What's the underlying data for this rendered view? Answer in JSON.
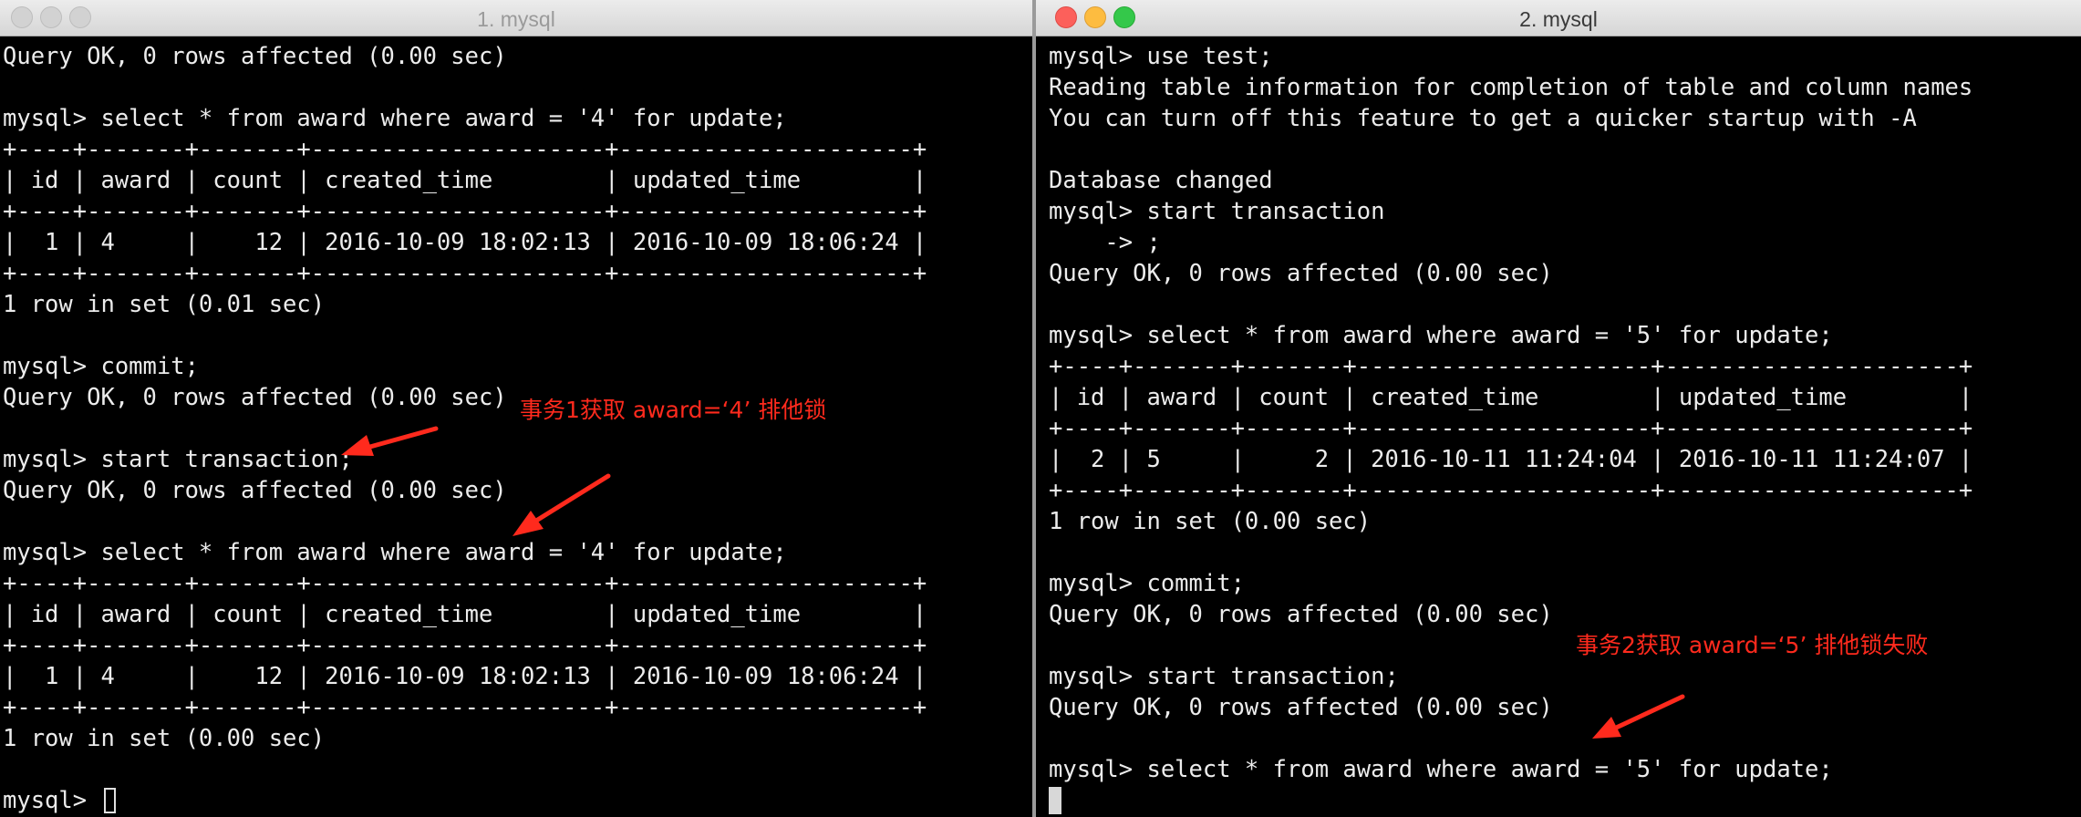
{
  "window1": {
    "title": "1. mysql",
    "lines": [
      "Query OK, 0 rows affected (0.00 sec)",
      "",
      "mysql> select * from award where award = '4' for update;",
      "+----+-------+-------+---------------------+---------------------+",
      "| id | award | count | created_time        | updated_time        |",
      "+----+-------+-------+---------------------+---------------------+",
      "|  1 | 4     |    12 | 2016-10-09 18:02:13 | 2016-10-09 18:06:24 |",
      "+----+-------+-------+---------------------+---------------------+",
      "1 row in set (0.01 sec)",
      "",
      "mysql> commit;",
      "Query OK, 0 rows affected (0.00 sec)",
      "",
      "mysql> start transaction;",
      "Query OK, 0 rows affected (0.00 sec)",
      "",
      "mysql> select * from award where award = '4' for update;",
      "+----+-------+-------+---------------------+---------------------+",
      "| id | award | count | created_time        | updated_time        |",
      "+----+-------+-------+---------------------+---------------------+",
      "|  1 | 4     |    12 | 2016-10-09 18:02:13 | 2016-10-09 18:06:24 |",
      "+----+-------+-------+---------------------+---------------------+",
      "1 row in set (0.00 sec)",
      ""
    ],
    "prompt": "mysql> ",
    "annotation": "事务1获取 award=‘4’ 排他锁"
  },
  "window2": {
    "title": "2. mysql",
    "lines": [
      "mysql> use test;",
      "Reading table information for completion of table and column names",
      "You can turn off this feature to get a quicker startup with -A",
      "",
      "Database changed",
      "mysql> start transaction",
      "    -> ;",
      "Query OK, 0 rows affected (0.00 sec)",
      "",
      "mysql> select * from award where award = '5' for update;",
      "+----+-------+-------+---------------------+---------------------+",
      "| id | award | count | created_time        | updated_time        |",
      "+----+-------+-------+---------------------+---------------------+",
      "|  2 | 5     |     2 | 2016-10-11 11:24:04 | 2016-10-11 11:24:07 |",
      "+----+-------+-------+---------------------+---------------------+",
      "1 row in set (0.00 sec)",
      "",
      "mysql> commit;",
      "Query OK, 0 rows affected (0.00 sec)",
      "",
      "mysql> start transaction;",
      "Query OK, 0 rows affected (0.00 sec)",
      "",
      "mysql> select * from award where award = '5' for update;"
    ],
    "annotation": "事务2获取 award=‘5’ 排他锁失败"
  },
  "colors": {
    "annotation": "#ff2a1d",
    "terminal_bg": "#000000",
    "terminal_fg": "#ececec"
  }
}
